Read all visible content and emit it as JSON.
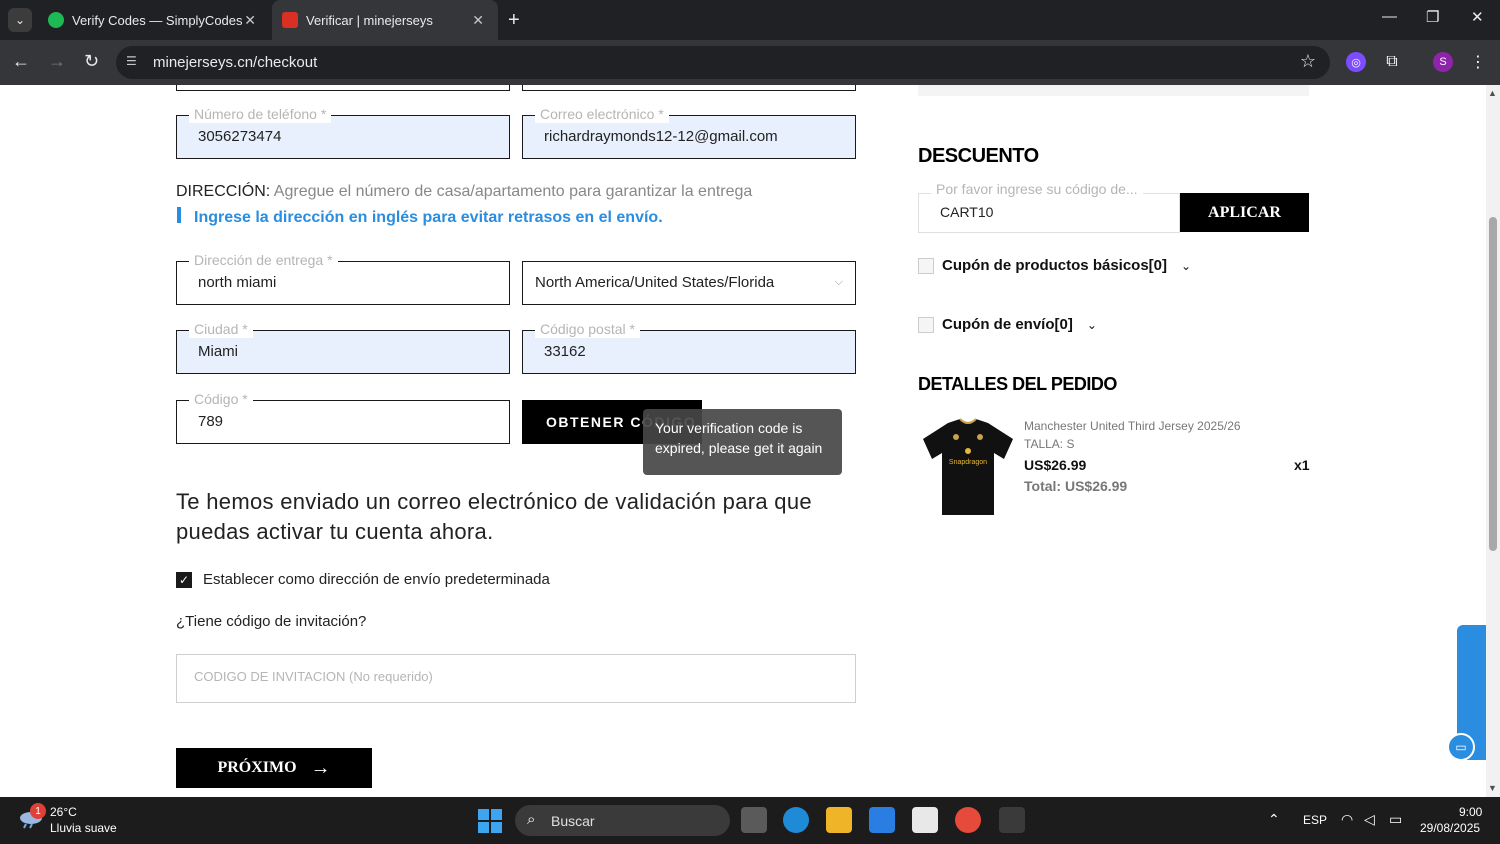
{
  "browser": {
    "tabs": [
      {
        "title": "Verify Codes — SimplyCodes",
        "active": false
      },
      {
        "title": "Verificar | minejerseys",
        "active": true
      }
    ],
    "url": "minejerseys.cn/checkout",
    "profile_initial": "S"
  },
  "form": {
    "phone": {
      "label": "Número de teléfono *",
      "value": "3056273474"
    },
    "email": {
      "label": "Correo electrónico *",
      "value": "richardraymonds12-12@gmail.com"
    },
    "direccion_label": "DIRECCIÓN:",
    "direccion_hint": "Agregue el número de casa/apartamento para garantizar la entrega",
    "info_notice": "Ingrese la dirección en inglés para evitar retrasos en el envío.",
    "address": {
      "label": "Dirección de entrega *",
      "value": "north miami"
    },
    "region": {
      "value": "North America/United States/Florida"
    },
    "city": {
      "label": "Ciudad *",
      "value": "Miami"
    },
    "postal": {
      "label": "Código postal *",
      "value": "33162"
    },
    "code": {
      "label": "Código *",
      "value": "789"
    },
    "get_code_button": "OBTENER CÓDIGO",
    "tooltip": "Your verification code is expired, please get it again",
    "sent_message": "Te hemos enviado un correo electrónico de validación para que puedas activar tu cuenta ahora.",
    "default_address_label": "Establecer como dirección de envío predeterminada",
    "default_address_checked": true,
    "invite_question": "¿Tiene código de invitación?",
    "invite_placeholder": "CODIGO DE INVITACION (No requerido)",
    "next_button": "PRÓXIMO"
  },
  "summary": {
    "discount_title": "DESCUENTO",
    "discount_label": "Por favor ingrese su código de...",
    "discount_value": "CART10",
    "apply_button": "APLICAR",
    "coupons": [
      {
        "label": "Cupón de productos básicos[0]"
      },
      {
        "label": "Cupón de envío[0]"
      }
    ],
    "order_title": "DETALLES DEL PEDIDO",
    "product": {
      "name": "Manchester United Third Jersey 2025/26",
      "size": "TALLA: S",
      "price": "US$26.99",
      "total": "Total: US$26.99",
      "qty": "x1",
      "sponsor_text": "Snapdragon"
    }
  },
  "online_chat": "Online Chat",
  "taskbar": {
    "weather_badge": "1",
    "temperature": "26°C",
    "weather": "Lluvia suave",
    "search": "Buscar",
    "language": "ESP",
    "time": "9:00",
    "date": "29/08/2025"
  }
}
